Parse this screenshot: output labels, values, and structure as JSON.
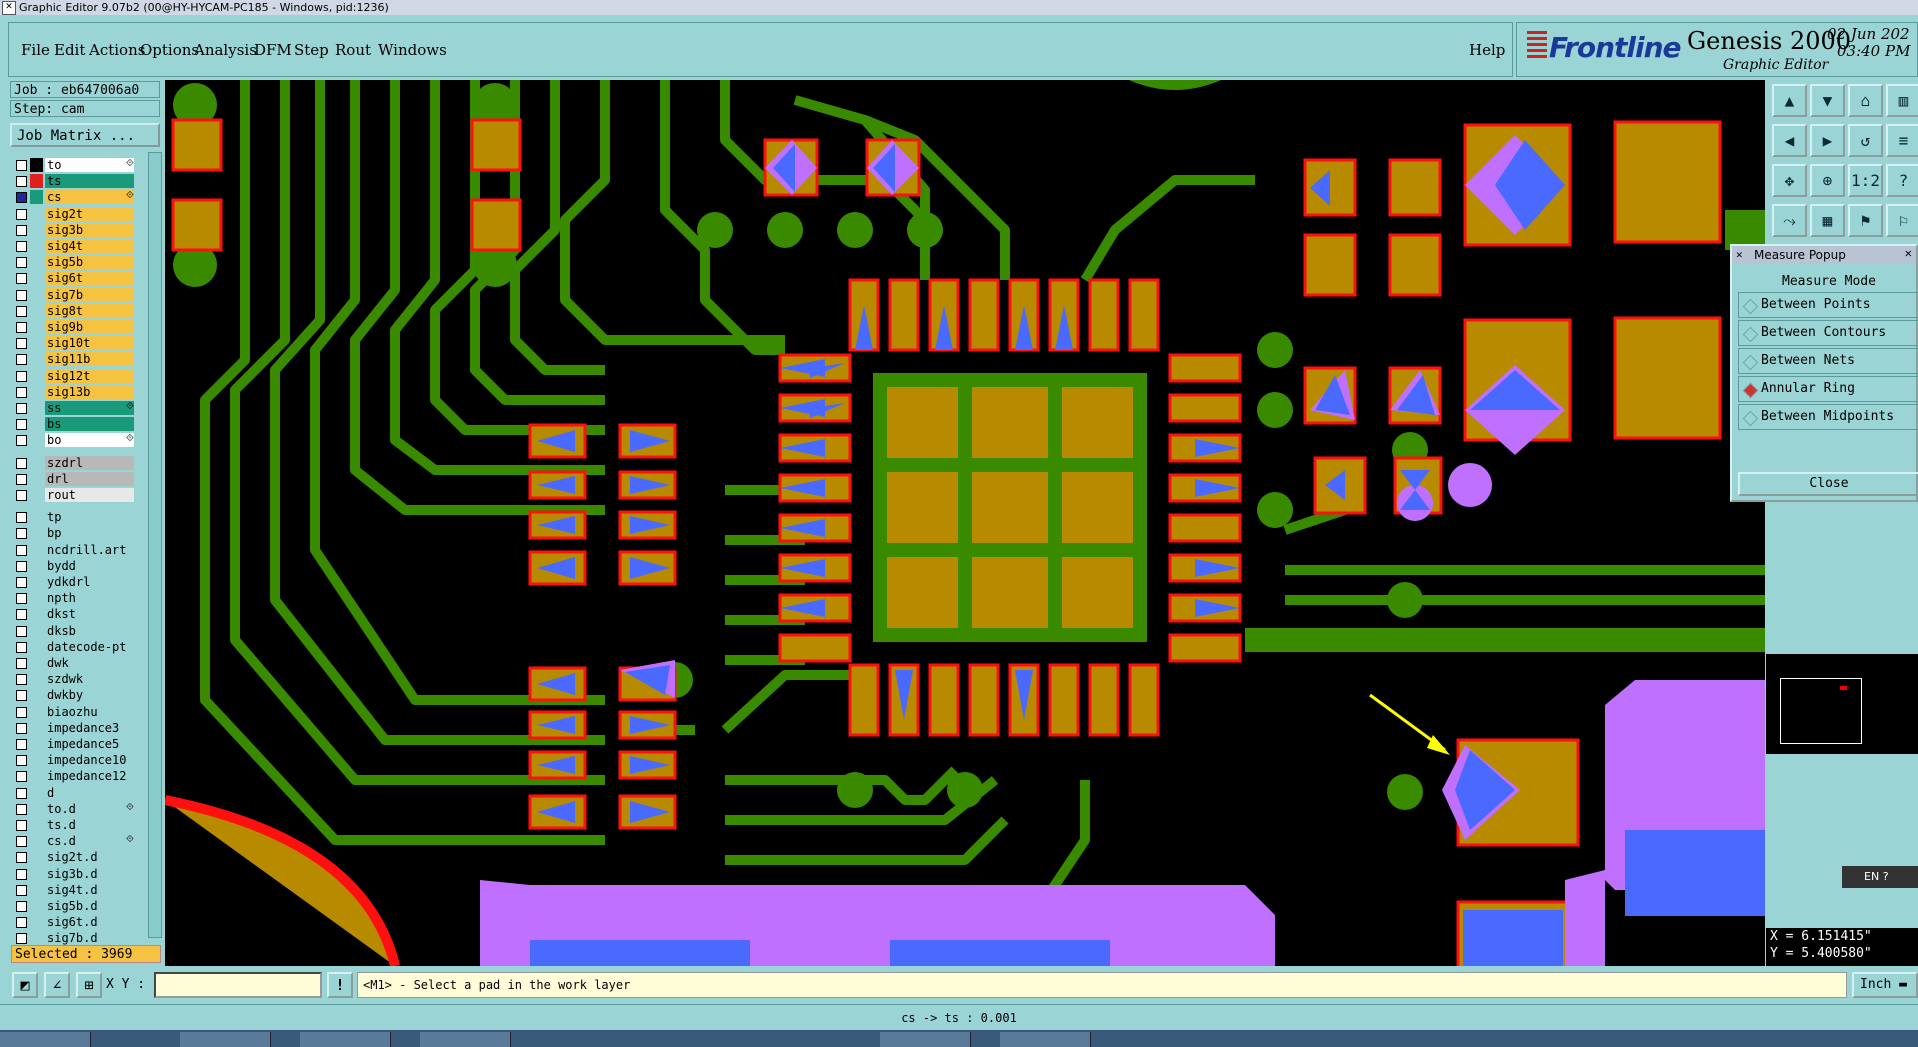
{
  "window_title": "Graphic Editor 9.07b2 (00@HY-HYCAM-PC185 - Windows, pid:1236)",
  "menu": {
    "items": [
      "File",
      "Edit",
      "Actions",
      "Options",
      "Analysis",
      "DFM",
      "Step",
      "Rout",
      "Windows"
    ],
    "help": "Help"
  },
  "brand": {
    "logo": "Frontline",
    "product": "Genesis 2000",
    "subtitle": "Graphic Editor",
    "date": "02 Jun 202",
    "time": "03:40 PM"
  },
  "job": {
    "job_line": "Job : eb647006a0",
    "step_line": "Step: cam",
    "matrix_button": "Job Matrix ..."
  },
  "layers": [
    {
      "name": "to",
      "color": "#ffffff",
      "swatch": "#000000",
      "marker": "⟐"
    },
    {
      "name": "ts",
      "color": "#1a9a7a",
      "swatch": "#e02020",
      "marker": ""
    },
    {
      "name": "cs",
      "color": "#f5c242",
      "swatch": "#1a9a7a",
      "marker": "⟐",
      "work": true
    },
    {
      "name": "sig2t",
      "color": "#f5c242",
      "swatch": "",
      "marker": ""
    },
    {
      "name": "sig3b",
      "color": "#f5c242",
      "swatch": "",
      "marker": ""
    },
    {
      "name": "sig4t",
      "color": "#f5c242",
      "swatch": "",
      "marker": ""
    },
    {
      "name": "sig5b",
      "color": "#f5c242",
      "swatch": "",
      "marker": ""
    },
    {
      "name": "sig6t",
      "color": "#f5c242",
      "swatch": "",
      "marker": ""
    },
    {
      "name": "sig7b",
      "color": "#f5c242",
      "swatch": "",
      "marker": ""
    },
    {
      "name": "sig8t",
      "color": "#f5c242",
      "swatch": "",
      "marker": ""
    },
    {
      "name": "sig9b",
      "color": "#f5c242",
      "swatch": "",
      "marker": ""
    },
    {
      "name": "sig10t",
      "color": "#f5c242",
      "swatch": "",
      "marker": ""
    },
    {
      "name": "sig11b",
      "color": "#f5c242",
      "swatch": "",
      "marker": ""
    },
    {
      "name": "sig12t",
      "color": "#f5c242",
      "swatch": "",
      "marker": ""
    },
    {
      "name": "sig13b",
      "color": "#f5c242",
      "swatch": "",
      "marker": ""
    },
    {
      "name": "ss",
      "color": "#1a9a7a",
      "swatch": "",
      "marker": "⟐"
    },
    {
      "name": "bs",
      "color": "#1a9a7a",
      "swatch": "",
      "marker": ""
    },
    {
      "name": "bo",
      "color": "#ffffff",
      "swatch": "",
      "marker": "⟐"
    },
    {
      "name": "szdrl",
      "color": "#b8b8b8",
      "swatch": "",
      "marker": "",
      "gap": true
    },
    {
      "name": "drl",
      "color": "#b8b8b8",
      "swatch": "",
      "marker": ""
    },
    {
      "name": "rout",
      "color": "#e8e8e8",
      "swatch": "",
      "marker": ""
    },
    {
      "name": "tp",
      "color": "#9ad4d4",
      "swatch": "",
      "marker": "",
      "gap": true
    },
    {
      "name": "bp",
      "color": "#9ad4d4",
      "swatch": "",
      "marker": ""
    },
    {
      "name": "ncdrill.art",
      "color": "#9ad4d4",
      "swatch": "",
      "marker": ""
    },
    {
      "name": "bydd",
      "color": "#9ad4d4",
      "swatch": "",
      "marker": ""
    },
    {
      "name": "ydkdrl",
      "color": "#9ad4d4",
      "swatch": "",
      "marker": ""
    },
    {
      "name": "npth",
      "color": "#9ad4d4",
      "swatch": "",
      "marker": ""
    },
    {
      "name": "dkst",
      "color": "#9ad4d4",
      "swatch": "",
      "marker": ""
    },
    {
      "name": "dksb",
      "color": "#9ad4d4",
      "swatch": "",
      "marker": ""
    },
    {
      "name": "datecode-pt",
      "color": "#9ad4d4",
      "swatch": "",
      "marker": ""
    },
    {
      "name": "dwk",
      "color": "#9ad4d4",
      "swatch": "",
      "marker": ""
    },
    {
      "name": "szdwk",
      "color": "#9ad4d4",
      "swatch": "",
      "marker": ""
    },
    {
      "name": "dwkby",
      "color": "#9ad4d4",
      "swatch": "",
      "marker": ""
    },
    {
      "name": "biaozhu",
      "color": "#9ad4d4",
      "swatch": "",
      "marker": ""
    },
    {
      "name": "impedance3",
      "color": "#9ad4d4",
      "swatch": "",
      "marker": ""
    },
    {
      "name": "impedance5",
      "color": "#9ad4d4",
      "swatch": "",
      "marker": ""
    },
    {
      "name": "impedance10",
      "color": "#9ad4d4",
      "swatch": "",
      "marker": ""
    },
    {
      "name": "impedance12",
      "color": "#9ad4d4",
      "swatch": "",
      "marker": ""
    },
    {
      "name": "d",
      "color": "#9ad4d4",
      "swatch": "",
      "marker": ""
    },
    {
      "name": "to.d",
      "color": "#9ad4d4",
      "swatch": "",
      "marker": "⟐"
    },
    {
      "name": "ts.d",
      "color": "#9ad4d4",
      "swatch": "",
      "marker": ""
    },
    {
      "name": "cs.d",
      "color": "#9ad4d4",
      "swatch": "",
      "marker": "⟐"
    },
    {
      "name": "sig2t.d",
      "color": "#9ad4d4",
      "swatch": "",
      "marker": ""
    },
    {
      "name": "sig3b.d",
      "color": "#9ad4d4",
      "swatch": "",
      "marker": ""
    },
    {
      "name": "sig4t.d",
      "color": "#9ad4d4",
      "swatch": "",
      "marker": ""
    },
    {
      "name": "sig5b.d",
      "color": "#9ad4d4",
      "swatch": "",
      "marker": ""
    },
    {
      "name": "sig6t.d",
      "color": "#9ad4d4",
      "swatch": "",
      "marker": ""
    },
    {
      "name": "sig7b.d",
      "color": "#9ad4d4",
      "swatch": "",
      "marker": ""
    }
  ],
  "selected": "Selected : 3969",
  "measure_popup": {
    "title": "Measure Popup",
    "heading": "Measure Mode",
    "options": [
      {
        "label": "Between Points",
        "active": false
      },
      {
        "label": "Between Contours",
        "active": false
      },
      {
        "label": "Between Nets",
        "active": false
      },
      {
        "label": "Annular Ring",
        "active": true
      },
      {
        "label": "Between Midpoints",
        "active": false
      }
    ],
    "close": "Close"
  },
  "tool_icons": [
    "layer-up-icon",
    "layer-down-icon",
    "home-icon",
    "column-icon",
    "prev-icon",
    "next-icon",
    "undo-icon",
    "list-icon",
    "fit-icon",
    "zoom-icon",
    "scale-icon",
    "help-icon",
    "snap-icon",
    "grid-icon",
    "net-icon",
    "net2-icon"
  ],
  "tool_glyphs": [
    "▲",
    "▼",
    "⌂",
    "▥",
    "◀",
    "▶",
    "↺",
    "≡",
    "✥",
    "⊕",
    "1:2",
    "?",
    "⤳",
    "▦",
    "⚑",
    "⚐"
  ],
  "ime": {
    "label": "EN",
    "help": "?"
  },
  "coords": {
    "x": "X = 6.151415\"",
    "y": "Y = 5.400580\""
  },
  "bottom": {
    "xy_label": "X Y :",
    "xy_value": "",
    "prompt": "<M1> - Select a pad in the work layer",
    "units": "Inch",
    "status": "cs -> ts : 0.001"
  },
  "colors": {
    "copper": "#b88a00",
    "trace": "#3a8a00",
    "pad_outline": "#ff1010",
    "mask": "#c070ff",
    "arrow": "#4a6aff",
    "pointer_arrow": "#ffff00"
  }
}
